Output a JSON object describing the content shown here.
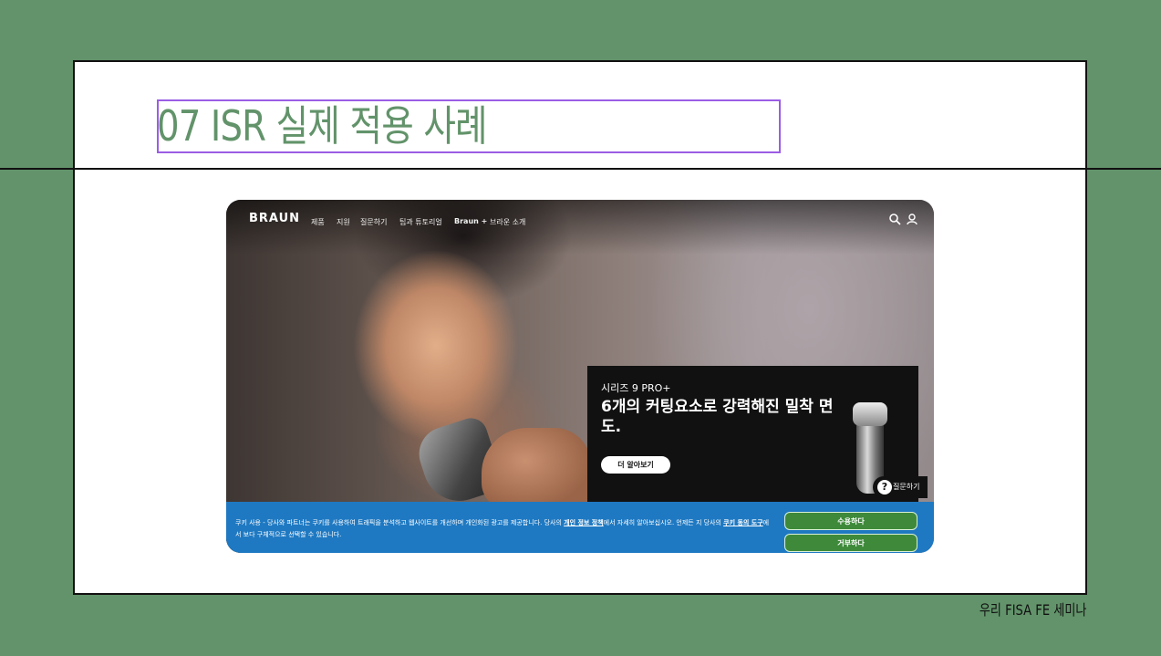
{
  "slide": {
    "title": "07 ISR 실제 적용 사례",
    "footer": "우리 FISA FE 세미나",
    "colors": {
      "background": "#62936a",
      "title": "#62936a",
      "title_box": "#9b5de5"
    }
  },
  "website": {
    "logo": "BRAUN",
    "nav": [
      "제품",
      "지원",
      "질문하기",
      "팁과 튜토리얼",
      "Braun +",
      "브라운 소개"
    ],
    "icons": [
      "search-icon",
      "user-icon"
    ],
    "promo": {
      "eyebrow": "시리즈 9 PRO+",
      "headline": "6개의 커팅요소로 강력해진 밀착 면도.",
      "button": "더 알아보기"
    },
    "ask_button": "질문하기",
    "cookie": {
      "text_before_link1": "쿠키 사용 - 당사와 파트너는 쿠키를 사용하여 트래픽을 분석하고 웹사이트를 개선하며 개인화된 광고를 제공합니다. 당사의 ",
      "link1": "개인 정보 정책",
      "text_after_link1": "에서 자세히 알아보십시오. 언제든 지 당사의 ",
      "link2": "쿠키 동의 도구",
      "text_after_link2": "에서 보다 구체적으로 선택할 수 있습니다.",
      "accept": "수용하다",
      "reject": "거부하다",
      "color": "#1f79c2"
    }
  }
}
